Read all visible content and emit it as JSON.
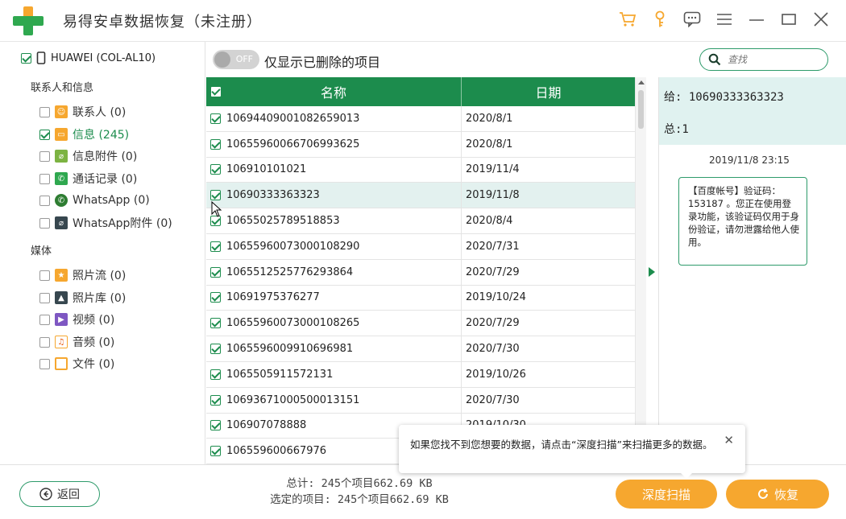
{
  "app": {
    "title": "易得安卓数据恢复（未注册）"
  },
  "colors": {
    "accent_green": "#1c8c4d",
    "accent_orange": "#f6a72f",
    "selected_row": "#e3f1ef"
  },
  "titlebar_icons": [
    "cart-icon",
    "key-icon",
    "feedback-icon",
    "menu-icon",
    "minimize-icon",
    "maximize-icon",
    "close-icon"
  ],
  "sidebar": {
    "device": "HUAWEI (COL-AL10)",
    "sections": [
      {
        "title": "联系人和信息",
        "items": [
          {
            "label": "联系人 (0)",
            "icon": "contacts-icon",
            "checked": false,
            "active": false
          },
          {
            "label": "信息 (245)",
            "icon": "messages-icon",
            "checked": true,
            "active": true
          },
          {
            "label": "信息附件 (0)",
            "icon": "attachment-icon",
            "checked": false,
            "active": false
          },
          {
            "label": "通话记录 (0)",
            "icon": "call-log-icon",
            "checked": false,
            "active": false
          },
          {
            "label": "WhatsApp (0)",
            "icon": "whatsapp-icon",
            "checked": false,
            "active": false
          },
          {
            "label": "WhatsApp附件 (0)",
            "icon": "whatsapp-attachment-icon",
            "checked": false,
            "active": false
          }
        ]
      },
      {
        "title": "媒体",
        "items": [
          {
            "label": "照片流 (0)",
            "icon": "photo-stream-icon",
            "checked": false,
            "active": false
          },
          {
            "label": "照片库 (0)",
            "icon": "photo-library-icon",
            "checked": false,
            "active": false
          },
          {
            "label": "视频 (0)",
            "icon": "video-icon",
            "checked": false,
            "active": false
          },
          {
            "label": "音频 (0)",
            "icon": "audio-icon",
            "checked": false,
            "active": false
          },
          {
            "label": "文件 (0)",
            "icon": "folder-icon",
            "checked": false,
            "active": false
          }
        ]
      }
    ]
  },
  "filter": {
    "toggle_text": "OFF",
    "label": "仅显示已删除的项目",
    "search_placeholder": "查找"
  },
  "table": {
    "columns": [
      "名称",
      "日期"
    ],
    "rows": [
      {
        "name": "10694409001082659013",
        "date": "2020/8/1",
        "selected": false
      },
      {
        "name": "10655960066706993625",
        "date": "2020/8/1",
        "selected": false
      },
      {
        "name": "106910101021",
        "date": "2019/11/4",
        "selected": false
      },
      {
        "name": "10690333363323",
        "date": "2019/11/8",
        "selected": true
      },
      {
        "name": "10655025789518853",
        "date": "2020/8/4",
        "selected": false
      },
      {
        "name": "10655960073000108290",
        "date": "2020/7/31",
        "selected": false
      },
      {
        "name": "1065512525776293864",
        "date": "2020/7/29",
        "selected": false
      },
      {
        "name": "10691975376277",
        "date": "2019/10/24",
        "selected": false
      },
      {
        "name": "10655960073000108265",
        "date": "2020/7/29",
        "selected": false
      },
      {
        "name": "1065596009910696981",
        "date": "2020/7/30",
        "selected": false
      },
      {
        "name": "1065505911572131",
        "date": "2019/10/26",
        "selected": false
      },
      {
        "name": "10693671000500013151",
        "date": "2020/7/30",
        "selected": false
      },
      {
        "name": "106907078888",
        "date": "2019/10/30",
        "selected": false
      },
      {
        "name": "106559600667976",
        "date": "",
        "selected": false
      }
    ]
  },
  "detail": {
    "to": "给:  10690333363323",
    "total": "总:1",
    "time": "2019/11/8 23:15",
    "message": "【百度帐号】验证码：153187 。您正在使用登录功能，该验证码仅用于身份验证，请勿泄露给他人使用。"
  },
  "footer": {
    "back_label": "返回",
    "total_line": "总计: 245个项目662.69 KB",
    "selected_line": "选定的项目: 245个项目662.69 KB",
    "deep_scan_label": "深度扫描",
    "recover_label": "恢复"
  },
  "tooltip": {
    "text": "如果您找不到您想要的数据，请点击“深度扫描”来扫描更多的数据。"
  }
}
